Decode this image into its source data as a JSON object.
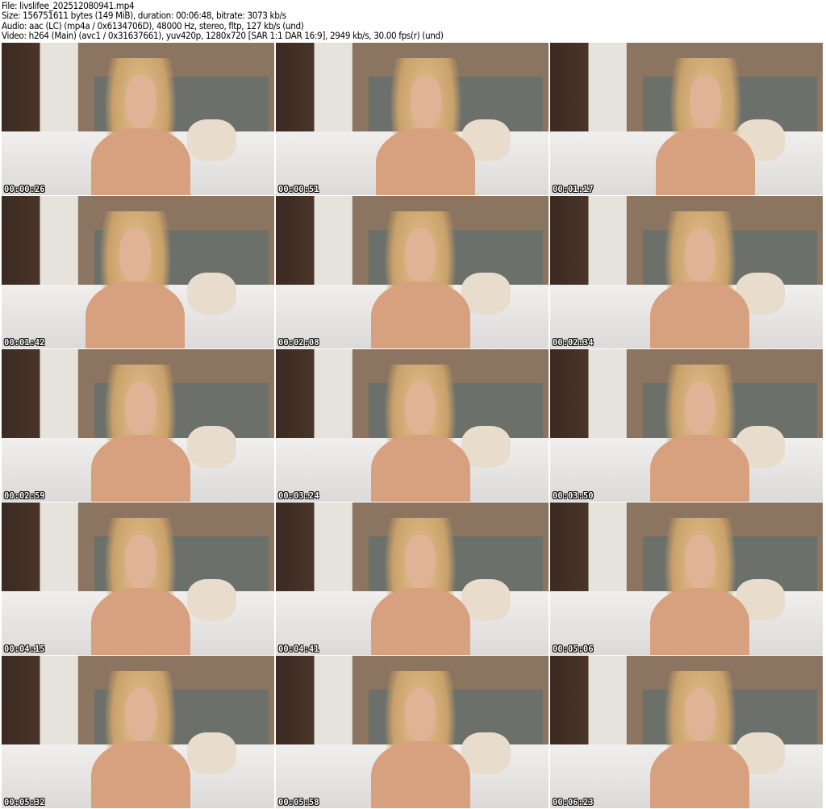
{
  "header": {
    "file": "File: livslifee_202512080941.mp4",
    "size": "Size: 156751611 bytes (149 MiB), duration: 00:06:48, bitrate: 3073 kb/s",
    "audio": "Audio: aac (LC) (mp4a / 0x6134706D), 48000 Hz, stereo, fltp, 127 kb/s (und)",
    "video": "Video: h264 (Main) (avc1 / 0x31637661), yuv420p, 1280x720 [SAR 1:1 DAR 16:9], 2949 kb/s, 30.00 fps(r) (und)"
  },
  "thumbnails": [
    {
      "timestamp": "00:00:26"
    },
    {
      "timestamp": "00:00:51"
    },
    {
      "timestamp": "00:01:17"
    },
    {
      "timestamp": "00:01:42"
    },
    {
      "timestamp": "00:02:08"
    },
    {
      "timestamp": "00:02:34"
    },
    {
      "timestamp": "00:02:59"
    },
    {
      "timestamp": "00:03:24"
    },
    {
      "timestamp": "00:03:50"
    },
    {
      "timestamp": "00:04:15"
    },
    {
      "timestamp": "00:04:41"
    },
    {
      "timestamp": "00:05:06"
    },
    {
      "timestamp": "00:05:32"
    },
    {
      "timestamp": "00:05:58"
    },
    {
      "timestamp": "00:06:23"
    }
  ]
}
